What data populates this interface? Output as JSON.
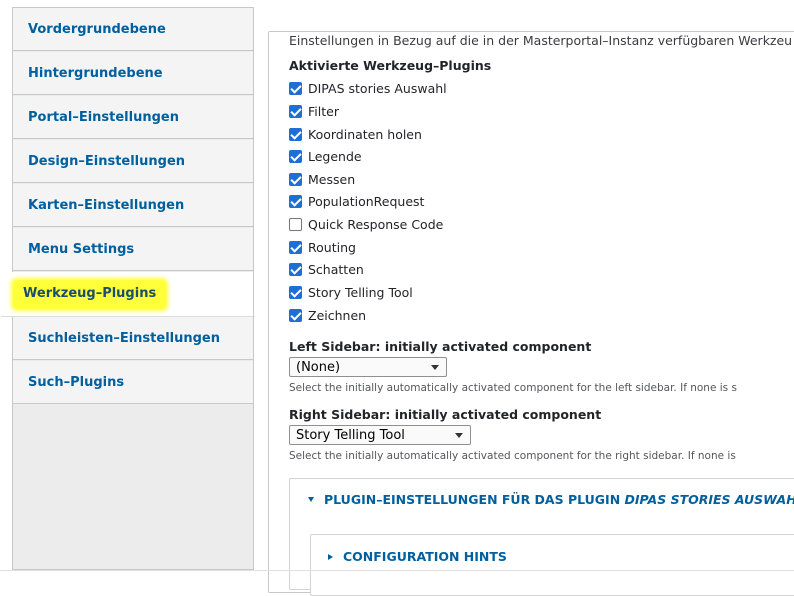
{
  "sidebar": {
    "tabs": [
      {
        "label": "Vordergrundebene",
        "active": false
      },
      {
        "label": "Hintergrundebene",
        "active": false
      },
      {
        "label": "Portal–Einstellungen",
        "active": false
      },
      {
        "label": "Design–Einstellungen",
        "active": false
      },
      {
        "label": "Karten–Einstellungen",
        "active": false
      },
      {
        "label": "Menu Settings",
        "active": false
      },
      {
        "label": "Werkzeug–Plugins",
        "active": true
      },
      {
        "label": "Suchleisten–Einstellungen",
        "active": false
      },
      {
        "label": "Such–Plugins",
        "active": false
      }
    ],
    "highlight_color": "#ffff3a"
  },
  "main": {
    "intro": "Einstellungen in Bezug auf die in der Masterportal–Instanz verfügbaren Werkzeu",
    "plugins_title": "Aktivierte Werkzeug–Plugins",
    "plugins": [
      {
        "label": "DIPAS stories Auswahl",
        "checked": true
      },
      {
        "label": "Filter",
        "checked": true
      },
      {
        "label": "Koordinaten holen",
        "checked": true
      },
      {
        "label": "Legende",
        "checked": true
      },
      {
        "label": "Messen",
        "checked": true
      },
      {
        "label": "PopulationRequest",
        "checked": true
      },
      {
        "label": "Quick Response Code",
        "checked": false
      },
      {
        "label": "Routing",
        "checked": true
      },
      {
        "label": "Schatten",
        "checked": true
      },
      {
        "label": "Story Telling Tool",
        "checked": true
      },
      {
        "label": "Zeichnen",
        "checked": true
      }
    ],
    "left_sidebar": {
      "label": "Left Sidebar: initially activated component",
      "value": "(None)",
      "description": "Select the initially automatically activated component for the left sidebar. If none is s"
    },
    "right_sidebar": {
      "label": "Right Sidebar: initially activated component",
      "value": "Story Telling Tool",
      "description": "Select the initially automatically activated component for the right sidebar. If none is"
    },
    "plugin_settings": {
      "prefix": "PLUGIN–EINSTELLUNGEN FÜR DAS PLUGIN ",
      "plugin_name": "DIPAS STORIES AUSWAHL"
    },
    "configuration_hints": "CONFIGURATION HINTS"
  },
  "colors": {
    "link": "#005f9e",
    "checkbox": "#1f6fd2"
  }
}
